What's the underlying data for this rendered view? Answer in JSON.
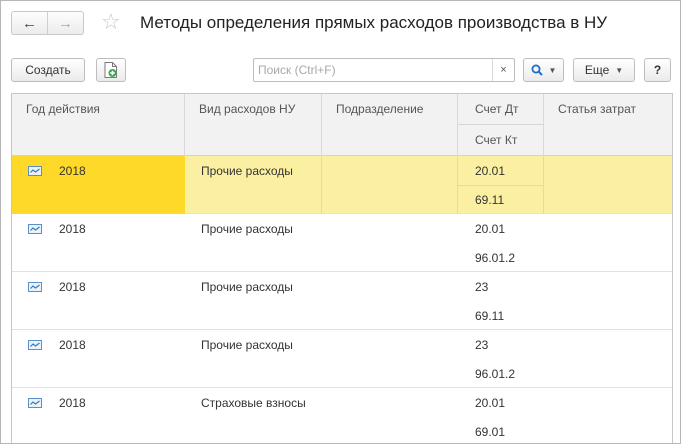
{
  "window": {
    "title": "Методы определения прямых расходов производства в НУ"
  },
  "nav": {
    "back_icon": "←",
    "forward_icon": "→",
    "favorite_icon": "☆"
  },
  "toolbar": {
    "create_label": "Создать",
    "search_placeholder": "Поиск (Ctrl+F)",
    "search_value": "",
    "clear_label": "×",
    "more_label": "Еще",
    "help_label": "?"
  },
  "table": {
    "columns": {
      "year": "Год действия",
      "kind": "Вид расходов НУ",
      "dept": "Подразделение",
      "acc_dt": "Счет Дт",
      "acc_kt": "Счет Кт",
      "cost_item": "Статья затрат"
    },
    "rows": [
      {
        "year": "2018",
        "kind": "Прочие расходы",
        "dept": "",
        "dt": "20.01",
        "kt": "69.11",
        "cost": "",
        "selected": true
      },
      {
        "year": "2018",
        "kind": "Прочие расходы",
        "dept": "",
        "dt": "20.01",
        "kt": "96.01.2",
        "cost": "",
        "selected": false
      },
      {
        "year": "2018",
        "kind": "Прочие расходы",
        "dept": "",
        "dt": "23",
        "kt": "69.11",
        "cost": "",
        "selected": false
      },
      {
        "year": "2018",
        "kind": "Прочие расходы",
        "dept": "",
        "dt": "23",
        "kt": "96.01.2",
        "cost": "",
        "selected": false
      },
      {
        "year": "2018",
        "kind": "Страховые взносы",
        "dept": "",
        "dt": "20.01",
        "kt": "69.01",
        "cost": "",
        "selected": false
      }
    ]
  },
  "colors": {
    "selected_row": "#fbf0a2",
    "selected_cell": "#fed929",
    "search_icon": "#1a6fc9"
  }
}
